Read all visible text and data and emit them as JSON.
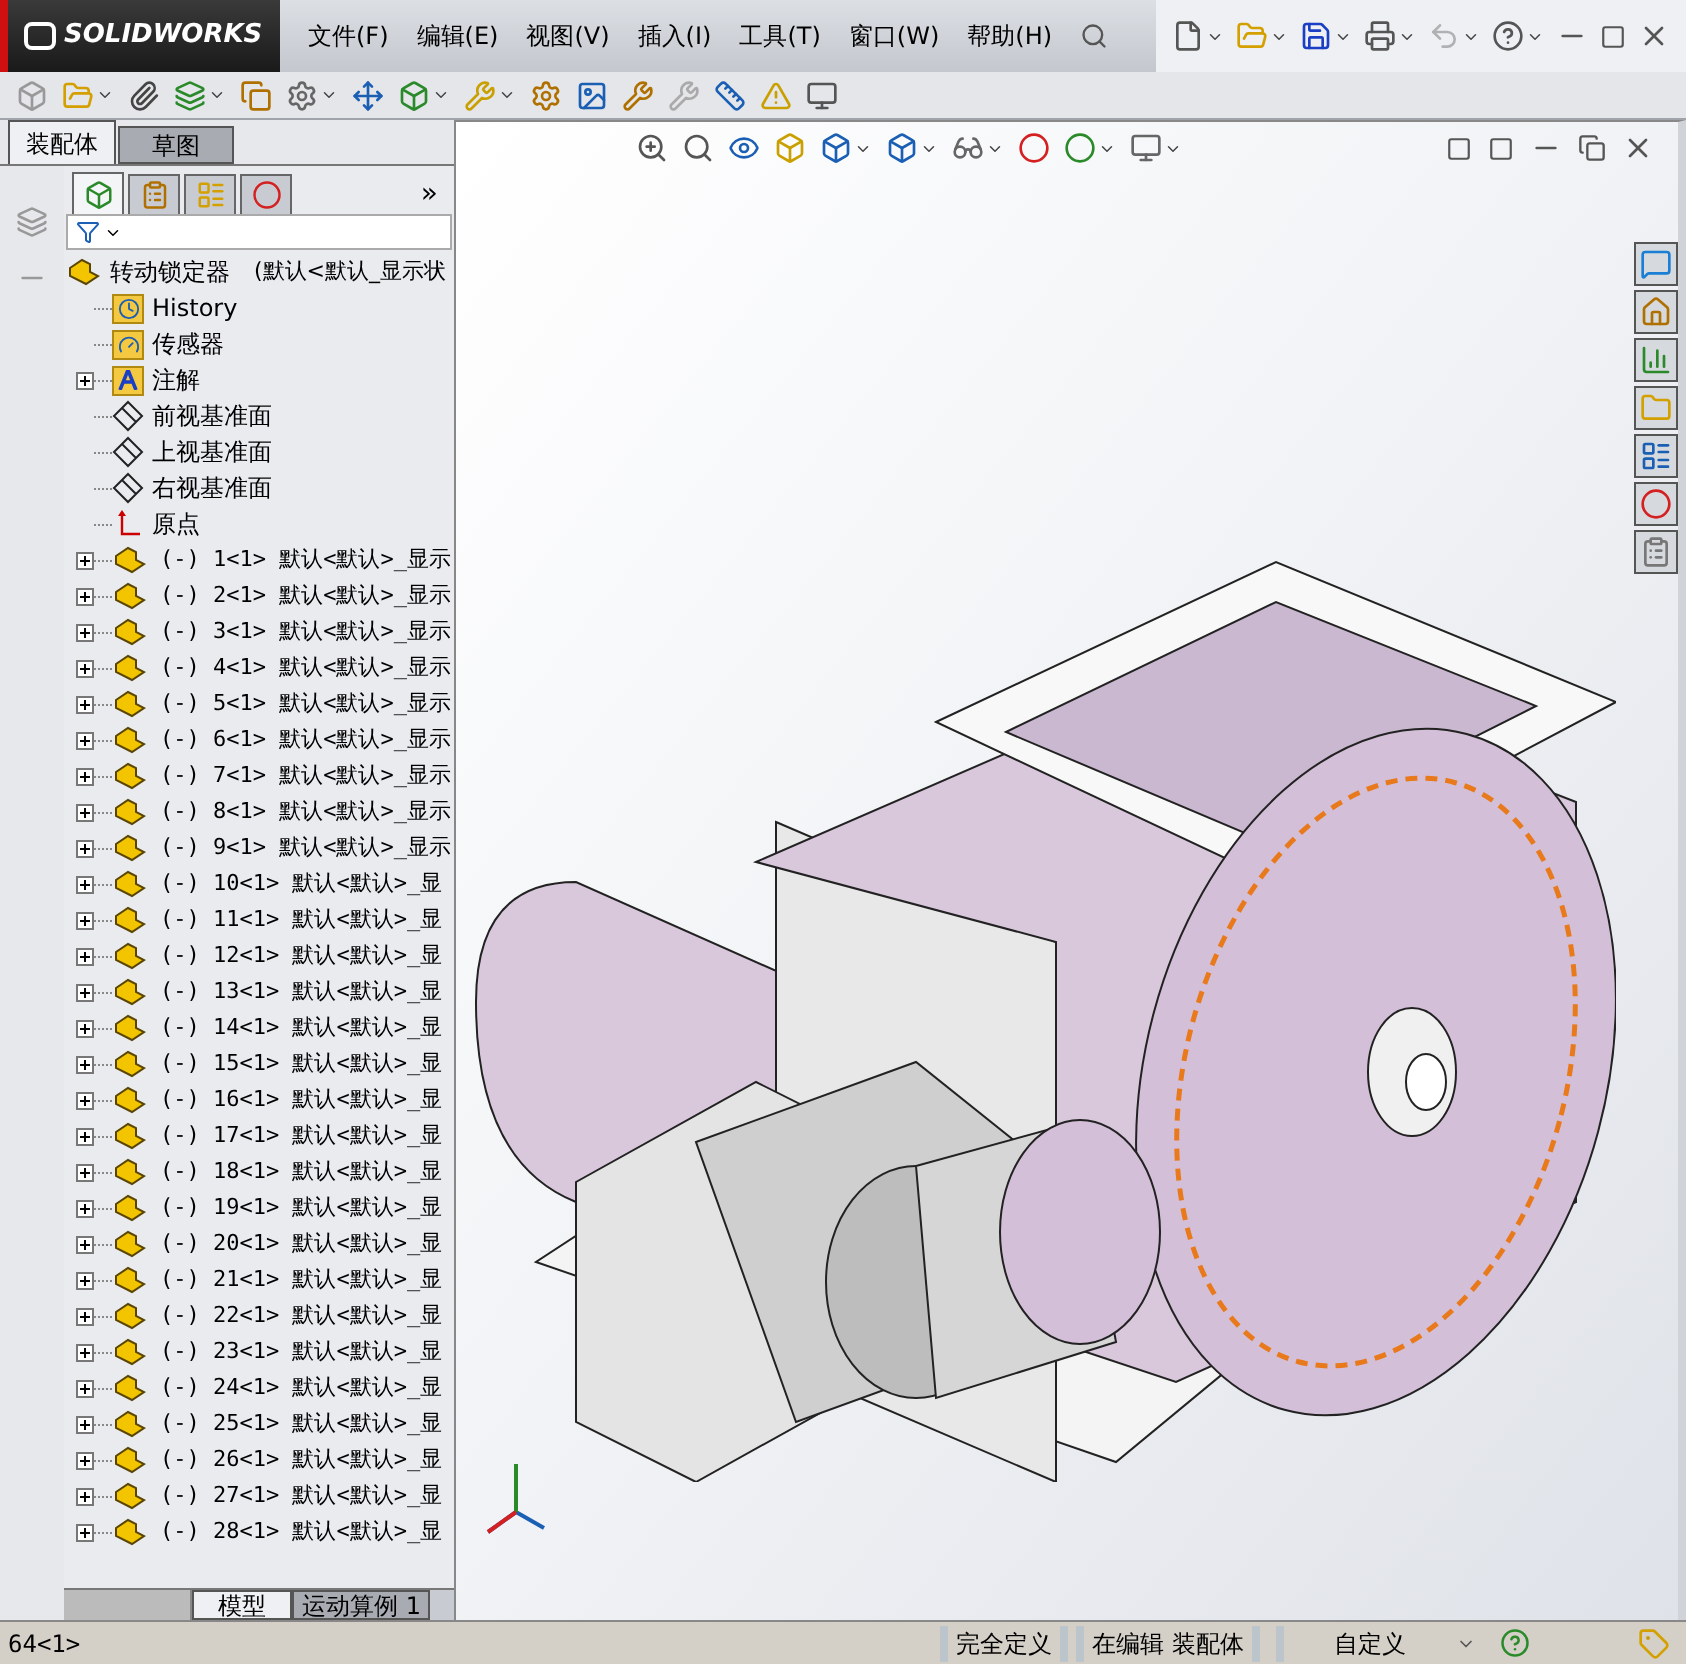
{
  "app": {
    "logo": "SOLIDWORKS",
    "menus": [
      "文件(F)",
      "编辑(E)",
      "视图(V)",
      "插入(I)",
      "工具(T)",
      "窗口(W)",
      "帮助(H)"
    ]
  },
  "command_tabs": [
    {
      "label": "装配体",
      "selected": true
    },
    {
      "label": "草图",
      "selected": false
    }
  ],
  "panel_tabs": [
    {
      "selected": true
    },
    {
      "selected": false
    },
    {
      "selected": false
    },
    {
      "selected": false
    }
  ],
  "panel_more": "»",
  "tree": {
    "root": {
      "label": "转动锁定器",
      "config": "(默认<默认_显示状"
    },
    "items": [
      {
        "kind": "history",
        "label": "History",
        "expandable": false
      },
      {
        "kind": "sensor",
        "label": "传感器",
        "expandable": false
      },
      {
        "kind": "annotation",
        "label": "注解",
        "expandable": true
      },
      {
        "kind": "plane",
        "label": "前视基准面",
        "expandable": false
      },
      {
        "kind": "plane",
        "label": "上视基准面",
        "expandable": false
      },
      {
        "kind": "plane",
        "label": "右视基准面",
        "expandable": false
      },
      {
        "kind": "origin",
        "label": "原点",
        "expandable": false
      },
      {
        "kind": "part",
        "label": "(-) 1<1> 默认<默认>_显示",
        "expandable": true
      },
      {
        "kind": "part",
        "label": "(-) 2<1> 默认<默认>_显示",
        "expandable": true
      },
      {
        "kind": "part",
        "label": "(-) 3<1> 默认<默认>_显示",
        "expandable": true
      },
      {
        "kind": "part",
        "label": "(-) 4<1> 默认<默认>_显示",
        "expandable": true
      },
      {
        "kind": "part",
        "label": "(-) 5<1> 默认<默认>_显示",
        "expandable": true
      },
      {
        "kind": "part",
        "label": "(-) 6<1> 默认<默认>_显示",
        "expandable": true
      },
      {
        "kind": "part",
        "label": "(-) 7<1> 默认<默认>_显示",
        "expandable": true
      },
      {
        "kind": "part",
        "label": "(-) 8<1> 默认<默认>_显示",
        "expandable": true
      },
      {
        "kind": "part",
        "label": "(-) 9<1> 默认<默认>_显示",
        "expandable": true
      },
      {
        "kind": "part",
        "label": "(-) 10<1> 默认<默认>_显",
        "expandable": true
      },
      {
        "kind": "part",
        "label": "(-) 11<1> 默认<默认>_显",
        "expandable": true
      },
      {
        "kind": "part",
        "label": "(-) 12<1> 默认<默认>_显",
        "expandable": true
      },
      {
        "kind": "part",
        "label": "(-) 13<1> 默认<默认>_显",
        "expandable": true
      },
      {
        "kind": "part",
        "label": "(-) 14<1> 默认<默认>_显",
        "expandable": true
      },
      {
        "kind": "part",
        "label": "(-) 15<1> 默认<默认>_显",
        "expandable": true
      },
      {
        "kind": "part",
        "label": "(-) 16<1> 默认<默认>_显",
        "expandable": true
      },
      {
        "kind": "part",
        "label": "(-) 17<1> 默认<默认>_显",
        "expandable": true
      },
      {
        "kind": "part",
        "label": "(-) 18<1> 默认<默认>_显",
        "expandable": true
      },
      {
        "kind": "part",
        "label": "(-) 19<1> 默认<默认>_显",
        "expandable": true
      },
      {
        "kind": "part",
        "label": "(-) 20<1> 默认<默认>_显",
        "expandable": true
      },
      {
        "kind": "part",
        "label": "(-) 21<1> 默认<默认>_显",
        "expandable": true
      },
      {
        "kind": "part",
        "label": "(-) 22<1> 默认<默认>_显",
        "expandable": true
      },
      {
        "kind": "part",
        "label": "(-) 23<1> 默认<默认>_显",
        "expandable": true
      },
      {
        "kind": "part",
        "label": "(-) 24<1> 默认<默认>_显",
        "expandable": true
      },
      {
        "kind": "part",
        "label": "(-) 25<1> 默认<默认>_显",
        "expandable": true
      },
      {
        "kind": "part",
        "label": "(-) 26<1> 默认<默认>_显",
        "expandable": true
      },
      {
        "kind": "part",
        "label": "(-) 27<1> 默认<默认>_显",
        "expandable": true
      },
      {
        "kind": "part",
        "label": "(-) 28<1> 默认<默认>_显",
        "expandable": true
      }
    ]
  },
  "model_tabs": [
    {
      "label": "模型",
      "selected": true
    },
    {
      "label": "运动算例 1",
      "selected": false
    }
  ],
  "status_bar": {
    "selection": "64<1>",
    "state": "完全定义",
    "mode": "在编辑 装配体",
    "units": "自定义"
  }
}
